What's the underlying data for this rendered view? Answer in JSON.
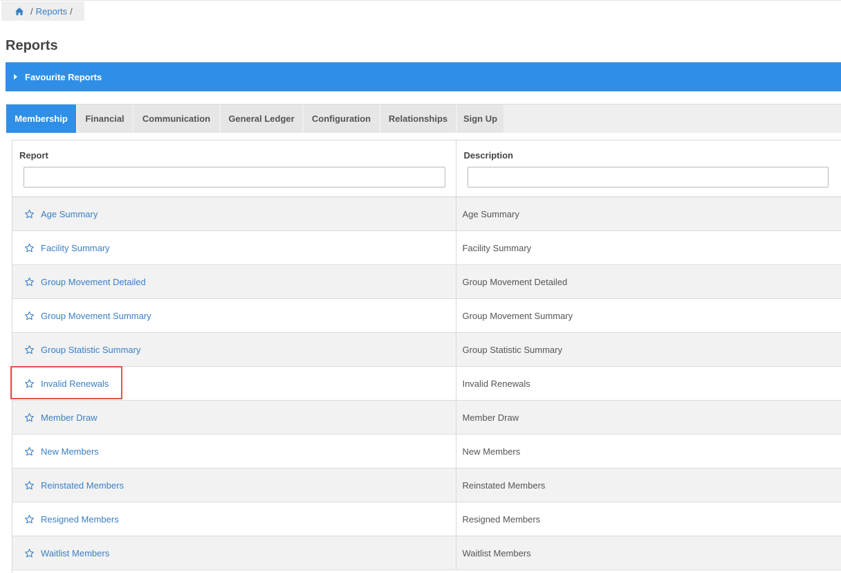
{
  "breadcrumb": {
    "home_icon": "home-icon",
    "items": [
      "Reports"
    ],
    "separator": "/"
  },
  "page": {
    "title": "Reports"
  },
  "favourites": {
    "label": "Favourite Reports",
    "icon": "caret-right-icon"
  },
  "tabs": [
    {
      "label": "Membership",
      "active": true
    },
    {
      "label": "Financial",
      "active": false
    },
    {
      "label": "Communication",
      "active": false
    },
    {
      "label": "General Ledger",
      "active": false
    },
    {
      "label": "Configuration",
      "active": false
    },
    {
      "label": "Relationships",
      "active": false
    },
    {
      "label": "Sign Up",
      "active": false
    }
  ],
  "table": {
    "columns": {
      "report": "Report",
      "description": "Description"
    },
    "filters": {
      "report_value": "",
      "description_value": ""
    },
    "rows": [
      {
        "report": "Age Summary",
        "description": "Age Summary"
      },
      {
        "report": "Facility Summary",
        "description": "Facility Summary"
      },
      {
        "report": "Group Movement Detailed",
        "description": "Group Movement Detailed"
      },
      {
        "report": "Group Movement Summary",
        "description": "Group Movement Summary"
      },
      {
        "report": "Group Statistic Summary",
        "description": "Group Statistic Summary"
      },
      {
        "report": "Invalid Renewals",
        "description": "Invalid Renewals"
      },
      {
        "report": "Member Draw",
        "description": "Member Draw"
      },
      {
        "report": "New Members",
        "description": "New Members"
      },
      {
        "report": "Reinstated Members",
        "description": "Reinstated Members"
      },
      {
        "report": "Resigned Members",
        "description": "Resigned Members"
      },
      {
        "report": "Waitlist Members",
        "description": "Waitlist Members"
      }
    ],
    "row_icon": "star-outline-icon"
  },
  "colors": {
    "accent": "#2f8fe6",
    "link": "#3a7fc4",
    "highlight": "#e5534b"
  }
}
